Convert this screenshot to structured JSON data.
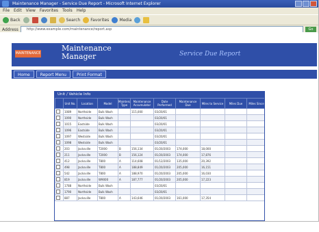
{
  "browser": {
    "title": "Maintenance Manager - Service Due Report - Microsoft Internet Explorer",
    "menu": [
      "File",
      "Edit",
      "View",
      "Favorites",
      "Tools",
      "Help"
    ],
    "toolbar": [
      "Back",
      "Search",
      "Favorites",
      "Media"
    ],
    "address_label": "Address",
    "address_url": "http://www.example.com/maintenance/report.asp",
    "go_label": "Go"
  },
  "app": {
    "logo_text": "MAINTENANCE",
    "title": "Maintenance Manager",
    "report_title": "Service Due Report",
    "nav": [
      "Home",
      "Report Menu",
      "Print Format"
    ]
  },
  "panel": {
    "heading": "Unit / Vehicle Info",
    "columns": [
      "",
      "Unit No.",
      "Location",
      "Model",
      "Maintenance Type",
      "Maintenance Accumulator",
      "Date Performed",
      "Maintenance Due",
      "Miles to Service",
      "Miles Due",
      "Miles Since"
    ],
    "rows": [
      [
        "",
        "1089",
        "Northside",
        "Bulk Wash",
        "",
        "115,000",
        "03/20/01",
        "",
        "",
        "",
        ""
      ],
      [
        "",
        "1090",
        "Northside",
        "Bulk Wash",
        "",
        "",
        "03/20/01",
        "",
        "",
        "",
        ""
      ],
      [
        "",
        "1015",
        "Eastside",
        "Bulk Wash",
        "",
        "",
        "03/20/01",
        "",
        "",
        "",
        ""
      ],
      [
        "",
        "1096",
        "Eastside",
        "Bulk Wash",
        "",
        "",
        "03/20/01",
        "",
        "",
        "",
        ""
      ],
      [
        "",
        "1097",
        "Westside",
        "Bulk Wash",
        "",
        "",
        "03/20/01",
        "",
        "",
        "",
        ""
      ],
      [
        "",
        "1098",
        "Westside",
        "Bulk Wash",
        "",
        "",
        "03/20/01",
        "",
        "",
        "",
        ""
      ],
      [
        "",
        "203",
        "Jacksville",
        "T2000",
        "B",
        "156,134",
        "01/20/2003",
        "174,000",
        "18,000",
        ""
      ],
      [
        "",
        "211",
        "Jacksville",
        "T2000",
        "B",
        "156,124",
        "01/20/2003",
        "174,000",
        "17,876",
        ""
      ],
      [
        "",
        "412",
        "Jacksville",
        "T800",
        "A",
        "114,608",
        "01/12/2003",
        "135,000",
        "20,392",
        ""
      ],
      [
        "",
        "498",
        "Jacksville",
        "T800",
        "A",
        "188,849",
        "01/20/2003",
        "205,000",
        "16,151",
        ""
      ],
      [
        "",
        "542",
        "Jacksville",
        "T800",
        "A",
        "188,970",
        "01/20/2003",
        "205,000",
        "16,030",
        ""
      ],
      [
        "",
        "819",
        "Jacksville",
        "W9000",
        "A",
        "187,777",
        "01/20/2003",
        "205,000",
        "17,223",
        ""
      ],
      [
        "",
        "1788",
        "Northside",
        "Bulk Wash",
        "",
        "",
        "03/20/01",
        "",
        "",
        "",
        ""
      ],
      [
        "",
        "1790",
        "Northside",
        "Bulk Wash",
        "",
        "",
        "03/20/01",
        "",
        "",
        "",
        ""
      ],
      [
        "",
        "887",
        "Jacksville",
        "T800",
        "A",
        "143,646",
        "01/20/2003",
        "161,000",
        "17,354",
        ""
      ]
    ]
  },
  "colors": {
    "banner": "#2f4fa8",
    "logo": "#e36a3a",
    "report_title": "#a9c3ff"
  }
}
